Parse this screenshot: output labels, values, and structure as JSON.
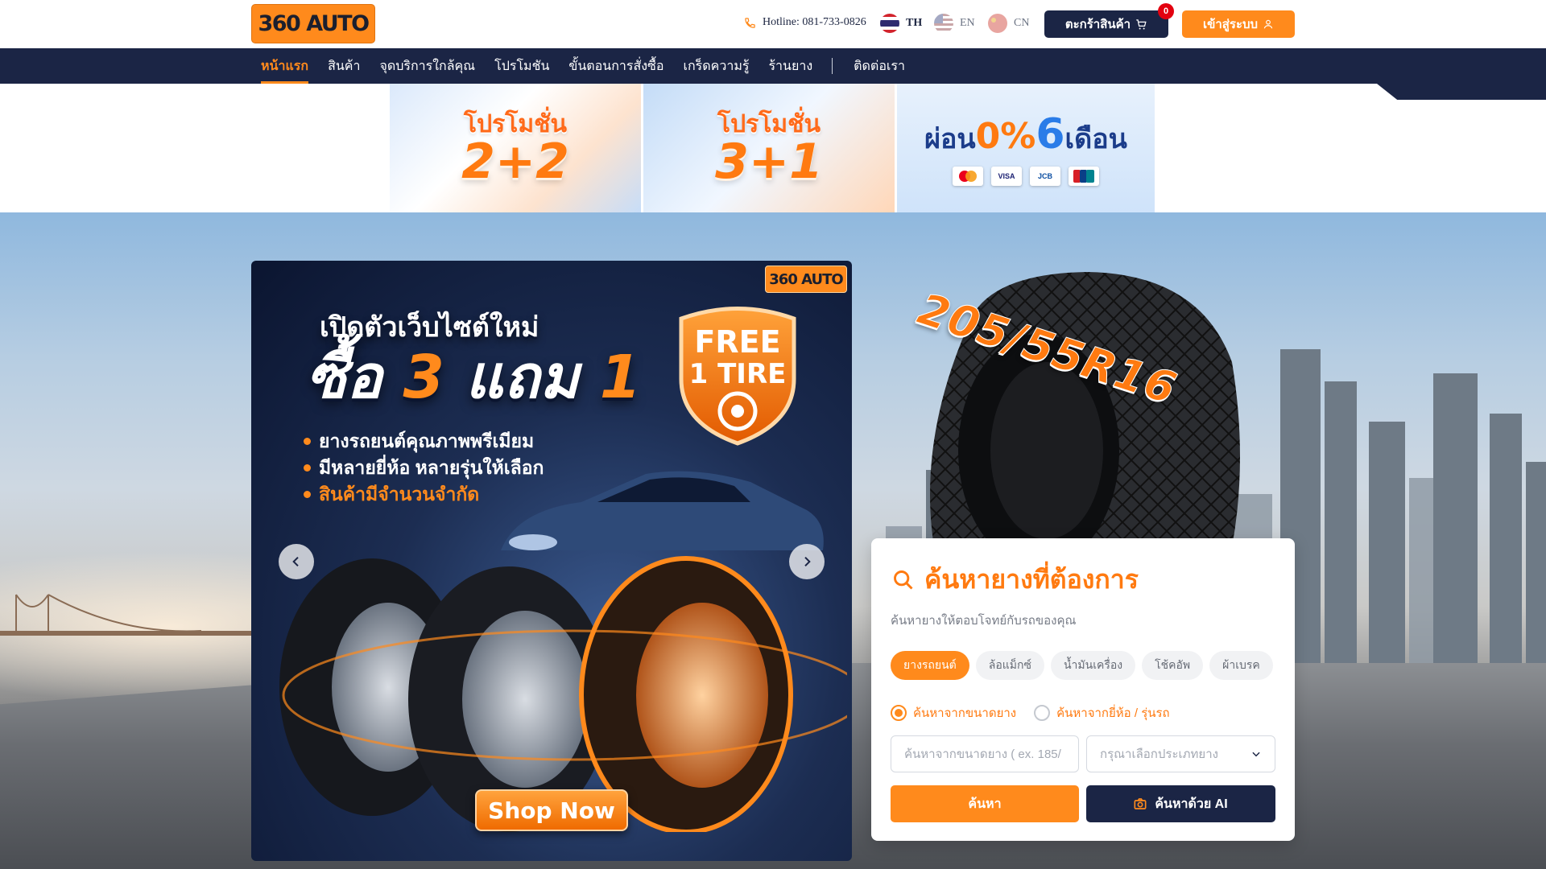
{
  "header": {
    "logo_text": "360 AUTO",
    "hotline": "Hotline: 081-733-0826",
    "languages": [
      {
        "code": "TH",
        "active": true
      },
      {
        "code": "EN",
        "active": false
      },
      {
        "code": "CN",
        "active": false
      }
    ],
    "cart_label": "ตะกร้าสินค้า",
    "cart_count": "0",
    "login_label": "เข้าสู่ระบบ"
  },
  "nav": {
    "items": [
      {
        "label": "หน้าแรก",
        "active": true
      },
      {
        "label": "สินค้า"
      },
      {
        "label": "จุดบริการใกล้คุณ"
      },
      {
        "label": "โปรโมชัน"
      },
      {
        "label": "ขั้นตอนการสั่งซื้อ"
      },
      {
        "label": "เกร็ดความรู้"
      },
      {
        "label": "ร้านยาง"
      }
    ],
    "contact_label": "ติดต่อเรา"
  },
  "promos": [
    {
      "title": "โปรโมชั่น",
      "big": "2+2"
    },
    {
      "title": "โปรโมชั่น",
      "big": "3+1"
    },
    {
      "prefix": "ผ่อน",
      "zero": "0%",
      "six": "6",
      "suffix": "เดือน",
      "cards": [
        "mastercard",
        "VISA",
        "JCB",
        "UnionPay"
      ]
    }
  ],
  "banner": {
    "logo_text": "360 AUTO",
    "headline": "เปิดตัวเว็บไซต์ใหม่",
    "offer_prefix": "ซื้อ",
    "offer_num1": "3",
    "offer_mid": "แถม",
    "offer_num2": "1",
    "badge_line1": "FREE",
    "badge_line2": "1 TIRE",
    "bullets": [
      "ยางรถยนต์คุณภาพพรีเมียม",
      "มีหลายยี่ห้อ หลายรุ่นให้เลือก",
      "สินค้ามีจำนวนจำกัด"
    ],
    "cta": "Shop Now"
  },
  "hero": {
    "tire_size": "205/55R16"
  },
  "search": {
    "title": "ค้นหายางที่ต้องการ",
    "subtitle": "ค้นหายางให้ตอบโจทย์กับรถของคุณ",
    "categories": [
      {
        "label": "ยางรถยนต์",
        "active": true
      },
      {
        "label": "ล้อแม็กซ์"
      },
      {
        "label": "น้ำมันเครื่อง"
      },
      {
        "label": "โช้คอัพ"
      },
      {
        "label": "ผ้าเบรค"
      }
    ],
    "modes": [
      {
        "label": "ค้นหาจากขนาดยาง",
        "checked": true
      },
      {
        "label": "ค้นหาจากยี่ห้อ / รุ่นรถ",
        "checked": false
      }
    ],
    "size_placeholder": "ค้นหาจากขนาดยาง ( ex. 185/",
    "type_placeholder": "กรุณาเลือกประเภทยาง",
    "search_btn": "ค้นหา",
    "ai_btn": "ค้นหาด้วย AI"
  },
  "colors": {
    "brand_orange": "#ff8a1c",
    "navy": "#1b2545",
    "badge_red": "#e3000f"
  }
}
